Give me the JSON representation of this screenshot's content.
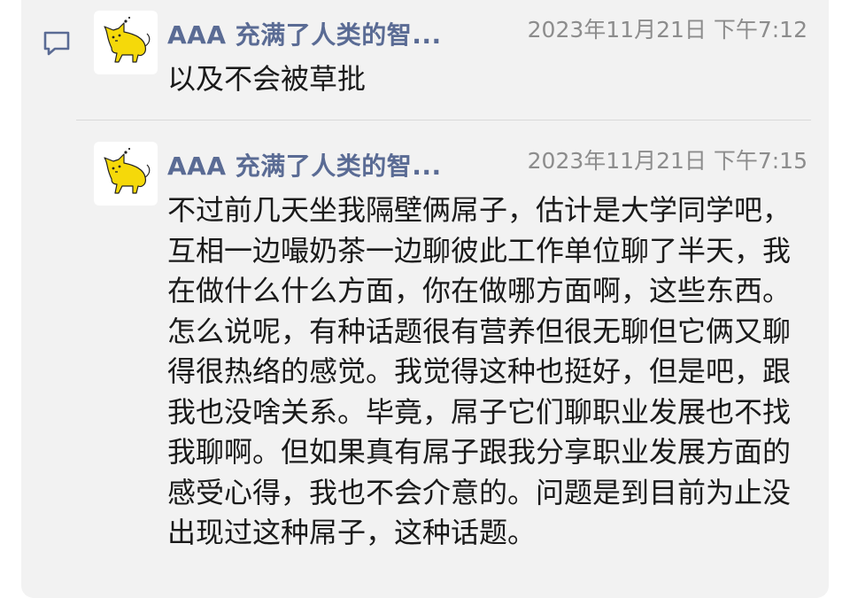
{
  "comment_thread": {
    "messages": [
      {
        "author": "AAA 充满了人类的智...",
        "time": "2023年11月21日 下午7:12",
        "text": "以及不会被草批",
        "avatar_icon": "yellow-cat-icon"
      },
      {
        "author": "AAA 充满了人类的智...",
        "time": "2023年11月21日 下午7:15",
        "text": "不过前几天坐我隔壁俩屌子，估计是大学同学吧，互相一边嘬奶茶一边聊彼此工作单位聊了半天，我在做什么什么方面，你在做哪方面啊，这些东西。怎么说呢，有种话题很有营养但很无聊但它俩又聊得很热络的感觉。我觉得这种也挺好，但是吧，跟我也没啥关系。毕竟，屌子它们聊职业发展也不找我聊啊。但如果真有屌子跟我分享职业发展方面的感受心得，我也不会介意的。问题是到目前为止没出现过这种屌子，这种话题。",
        "avatar_icon": "yellow-cat-icon"
      }
    ]
  },
  "colors": {
    "panel_background": "#f2f2f2",
    "author": "#5a6b94",
    "time": "#8c8c8c",
    "text": "#1a1a1a",
    "icon": "#5a6b94",
    "avatar_cat": "#f5d90a"
  }
}
